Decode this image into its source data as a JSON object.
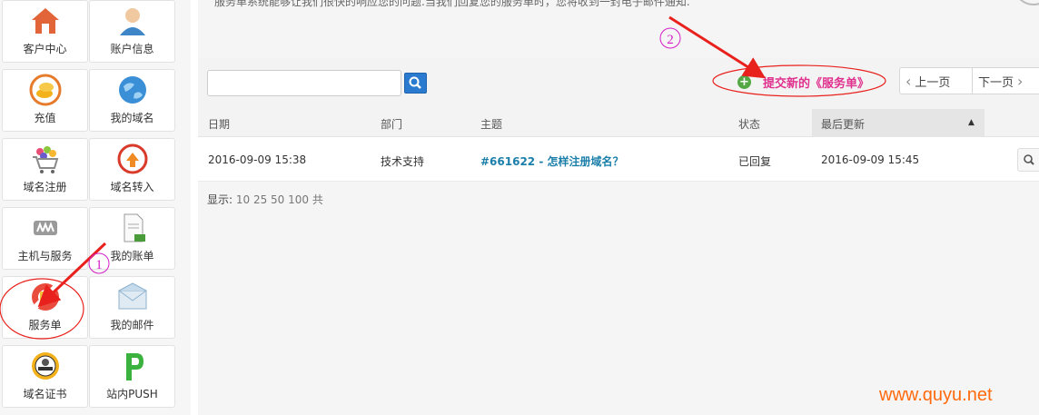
{
  "sidebar": {
    "tiles": [
      {
        "label": "客户中心",
        "icon": "home-icon"
      },
      {
        "label": "账户信息",
        "icon": "user-icon"
      },
      {
        "label": "充值",
        "icon": "coins-icon"
      },
      {
        "label": "我的域名",
        "icon": "globe-icon"
      },
      {
        "label": "域名注册",
        "icon": "cart-icon"
      },
      {
        "label": "域名转入",
        "icon": "transfer-icon"
      },
      {
        "label": "主机与服务",
        "icon": "server-icon"
      },
      {
        "label": "我的账单",
        "icon": "bill-icon"
      },
      {
        "label": "服务单",
        "icon": "lifebuoy-icon"
      },
      {
        "label": "我的邮件",
        "icon": "mail-icon"
      },
      {
        "label": "域名证书",
        "icon": "certificate-icon"
      },
      {
        "label": "站内PUSH",
        "icon": "push-icon"
      }
    ]
  },
  "intro_text": "服务单系统能够让我们很快的响应您的问题.当我们回复您的服务单时，您将收到一封电子邮件通知.",
  "search": {
    "value": "",
    "placeholder": ""
  },
  "new_ticket_label": "提交新的《服务单》",
  "pager": {
    "prev": "上一页",
    "next": "下一页"
  },
  "table": {
    "columns": [
      "日期",
      "部门",
      "主题",
      "状态",
      "最后更新"
    ],
    "rows": [
      {
        "date": "2016-09-09 15:38",
        "department": "技术支持",
        "subject": "#661622 - 怎样注册域名？",
        "status": "已回复",
        "last_update": "2016-09-09 15:45"
      }
    ]
  },
  "display": {
    "label": "显示:",
    "options": "10 25 50 100 共"
  },
  "annotations": {
    "marker1": "1",
    "marker2": "2"
  },
  "watermark": "www.quyu.net",
  "colors": {
    "accent_pink": "#e0308d",
    "link_blue": "#1b7fa9",
    "annotation_red": "#e8211d",
    "marker_magenta": "#d41ec8",
    "watermark_orange": "#ff6a0e"
  }
}
